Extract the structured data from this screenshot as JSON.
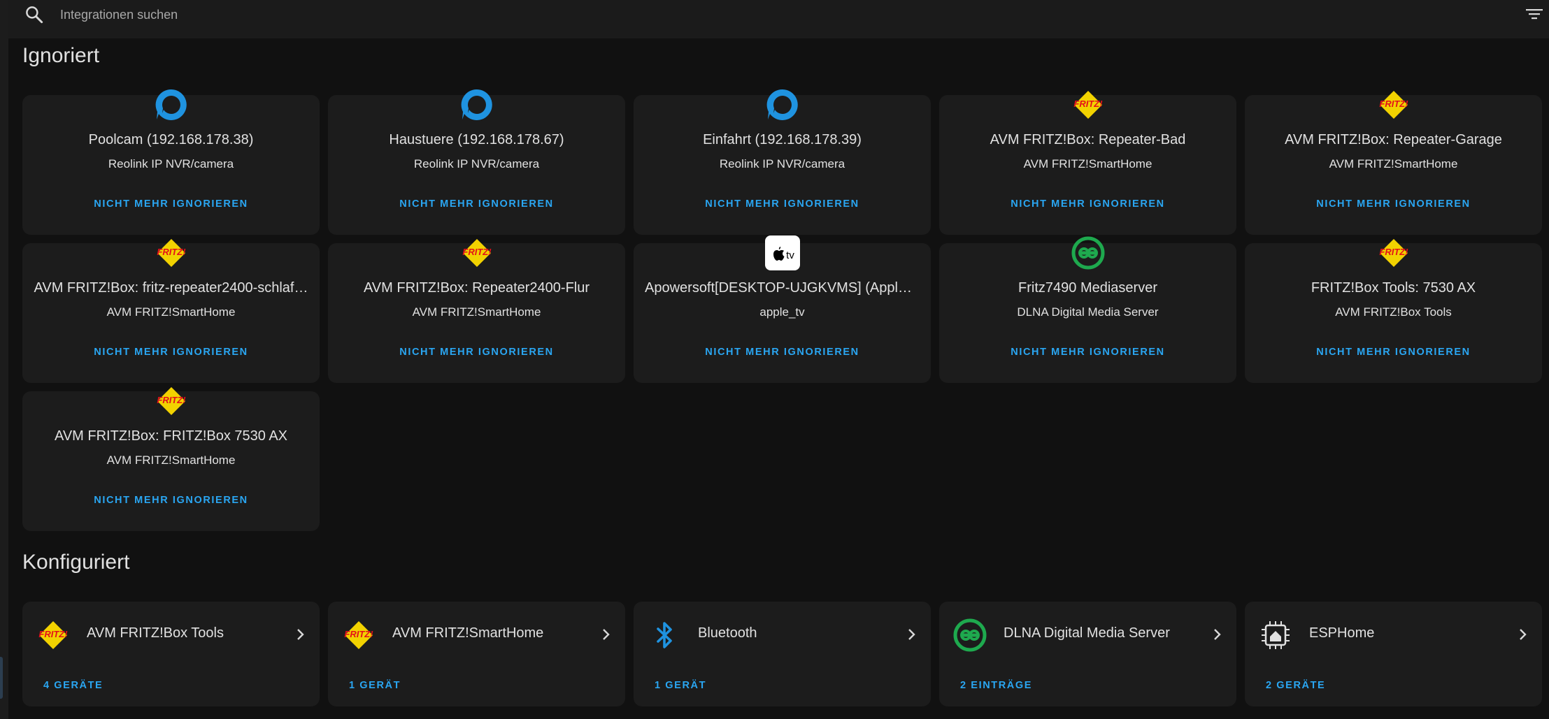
{
  "search": {
    "placeholder": "Integrationen suchen"
  },
  "sections": {
    "ignored_title": "Ignoriert",
    "configured_title": "Konfiguriert"
  },
  "ignored": [
    {
      "title": "Poolcam (192.168.178.38)",
      "subtitle": "Reolink IP NVR/camera",
      "action": "NICHT MEHR IGNORIEREN",
      "icon": "reolink-icon"
    },
    {
      "title": "Haustuere (192.168.178.67)",
      "subtitle": "Reolink IP NVR/camera",
      "action": "NICHT MEHR IGNORIEREN",
      "icon": "reolink-icon"
    },
    {
      "title": "Einfahrt (192.168.178.39)",
      "subtitle": "Reolink IP NVR/camera",
      "action": "NICHT MEHR IGNORIEREN",
      "icon": "reolink-icon"
    },
    {
      "title": "AVM FRITZ!Box: Repeater-Bad",
      "subtitle": "AVM FRITZ!SmartHome",
      "action": "NICHT MEHR IGNORIEREN",
      "icon": "fritz-icon"
    },
    {
      "title": "AVM FRITZ!Box: Repeater-Garage",
      "subtitle": "AVM FRITZ!SmartHome",
      "action": "NICHT MEHR IGNORIEREN",
      "icon": "fritz-icon"
    },
    {
      "title": "AVM FRITZ!Box: fritz-repeater2400-schlaf…",
      "subtitle": "AVM FRITZ!SmartHome",
      "action": "NICHT MEHR IGNORIEREN",
      "icon": "fritz-icon"
    },
    {
      "title": "AVM FRITZ!Box: Repeater2400-Flur",
      "subtitle": "AVM FRITZ!SmartHome",
      "action": "NICHT MEHR IGNORIEREN",
      "icon": "fritz-icon"
    },
    {
      "title": "Apowersoft[DESKTOP-UJGKVMS] (Apple…",
      "subtitle": "apple_tv",
      "action": "NICHT MEHR IGNORIEREN",
      "icon": "apple-tv-icon"
    },
    {
      "title": "Fritz7490 Mediaserver",
      "subtitle": "DLNA Digital Media Server",
      "action": "NICHT MEHR IGNORIEREN",
      "icon": "dlna-icon"
    },
    {
      "title": "FRITZ!Box Tools: 7530 AX",
      "subtitle": "AVM FRITZ!Box Tools",
      "action": "NICHT MEHR IGNORIEREN",
      "icon": "fritz-icon"
    },
    {
      "title": "AVM FRITZ!Box: FRITZ!Box 7530 AX",
      "subtitle": "AVM FRITZ!SmartHome",
      "action": "NICHT MEHR IGNORIEREN",
      "icon": "fritz-icon"
    }
  ],
  "configured": [
    {
      "name": "AVM FRITZ!Box Tools",
      "count": "4 GERÄTE",
      "icon": "fritz-icon"
    },
    {
      "name": "AVM FRITZ!SmartHome",
      "count": "1 GERÄT",
      "icon": "fritz-icon"
    },
    {
      "name": "Bluetooth",
      "count": "1 GERÄT",
      "icon": "bluetooth-icon"
    },
    {
      "name": "DLNA Digital Media Server",
      "count": "2 EINTRÄGE",
      "icon": "dlna-icon"
    },
    {
      "name": "ESPHome",
      "count": "2 GERÄTE",
      "icon": "esphome-icon"
    }
  ],
  "fritz_logo_text": "FRITZ!",
  "apple_tv_logo_text": "tv",
  "colors": {
    "accent": "#2aa6f2",
    "background": "#111111",
    "card": "#1c1c1c"
  }
}
